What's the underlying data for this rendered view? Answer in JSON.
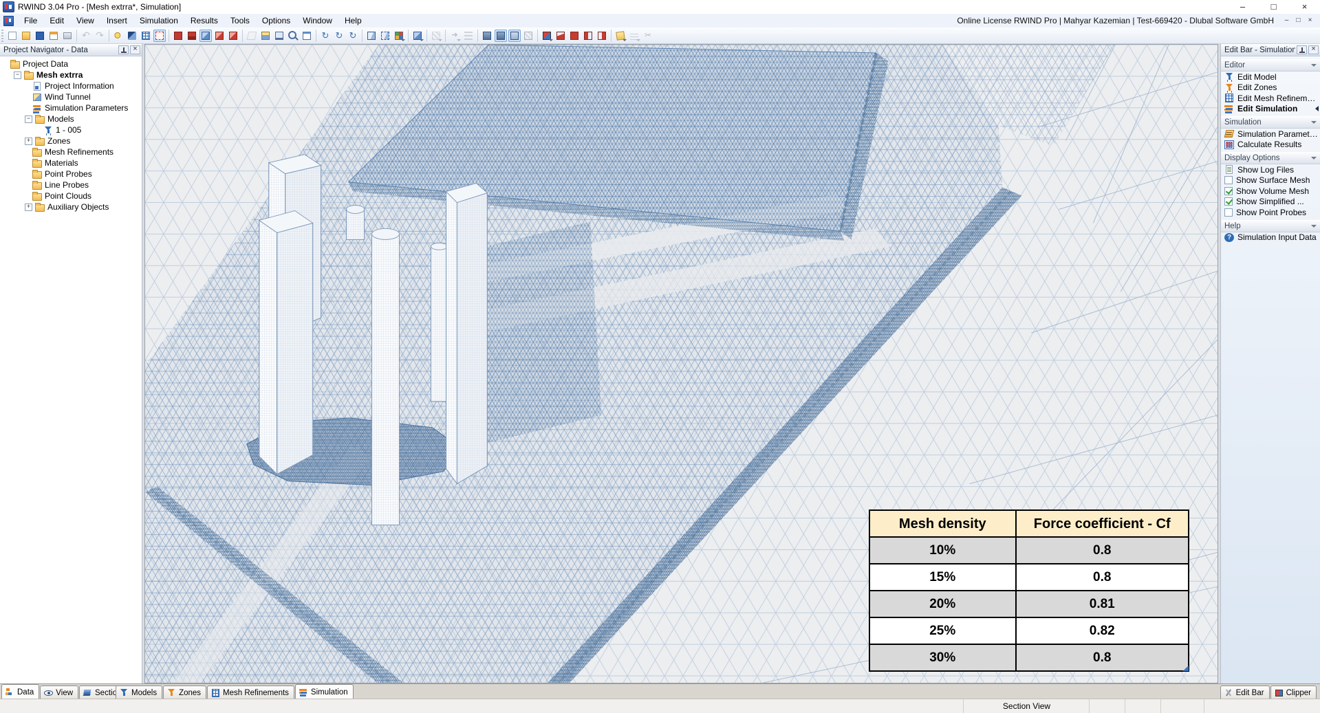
{
  "window": {
    "title": "RWIND 3.04 Pro - [Mesh extrra*, Simulation]"
  },
  "menu": {
    "items": [
      "File",
      "Edit",
      "View",
      "Insert",
      "Simulation",
      "Results",
      "Tools",
      "Options",
      "Window",
      "Help"
    ],
    "license": "Online License RWIND Pro | Mahyar Kazemian | Test-669420 - Dlubal Software GmbH"
  },
  "toolbar": {
    "icons": [
      {
        "name": "new-project",
        "kind": "sheet"
      },
      {
        "name": "open-project",
        "kind": "folder"
      },
      {
        "name": "save-project",
        "kind": "disk"
      },
      {
        "name": "project-navigator-toggle",
        "kind": "winpanel"
      },
      {
        "name": "print",
        "kind": "printer"
      },
      {
        "sep": true
      },
      {
        "name": "undo",
        "kind": "undo",
        "disabled": true
      },
      {
        "name": "redo",
        "kind": "redo",
        "disabled": true
      },
      {
        "sep": true
      },
      {
        "name": "generate-mesh",
        "kind": "spark"
      },
      {
        "name": "render-mode",
        "kind": "brush"
      },
      {
        "name": "finite-element-grid",
        "kind": "gridp"
      },
      {
        "name": "snap-grid",
        "kind": "snapred",
        "active": true
      },
      {
        "sep": true
      },
      {
        "name": "wind-tunnel-display",
        "kind": "redscreen"
      },
      {
        "name": "wind-tunnel-hide",
        "kind": "redscreen2"
      },
      {
        "name": "zone-box",
        "kind": "bluecube",
        "active": true
      },
      {
        "name": "zone-box-red",
        "kind": "redcube"
      },
      {
        "name": "zone-box-red-2",
        "kind": "redcube2"
      },
      {
        "sep": true
      },
      {
        "name": "screenshot",
        "kind": "grayiso",
        "disabled": true
      },
      {
        "name": "background-image",
        "kind": "imgfolder"
      },
      {
        "name": "display-window",
        "kind": "screen"
      },
      {
        "name": "zoom-window",
        "kind": "magnifier"
      },
      {
        "name": "message-log",
        "kind": "msgbox"
      },
      {
        "sep": true
      },
      {
        "name": "rotate-view",
        "kind": "rot"
      },
      {
        "name": "rotate-view-2",
        "kind": "rot"
      },
      {
        "name": "rotate-view-3",
        "kind": "rot"
      },
      {
        "sep": true
      },
      {
        "name": "isometric-view",
        "kind": "axcube"
      },
      {
        "name": "perspective-view",
        "kind": "axcube2"
      },
      {
        "name": "display-colors",
        "kind": "palette",
        "dd": true
      },
      {
        "sep": true
      },
      {
        "name": "solid-display",
        "kind": "bluecube",
        "dd": true
      },
      {
        "sep": true
      },
      {
        "name": "hatch-display",
        "kind": "hatch",
        "disabled": true,
        "dd": true
      },
      {
        "sep": true
      },
      {
        "name": "drag-mode",
        "kind": "movearrow",
        "disabled": true,
        "dd": true
      },
      {
        "name": "level-display",
        "kind": "levels",
        "disabled": true
      },
      {
        "sep": true
      },
      {
        "name": "surface-mesh-display",
        "kind": "face1"
      },
      {
        "name": "volume-mesh-display",
        "kind": "face2",
        "active": true
      },
      {
        "name": "simplified-mesh-display",
        "kind": "face3",
        "active": true
      },
      {
        "name": "probe-display",
        "kind": "face4",
        "disabled": true
      },
      {
        "sep": true
      },
      {
        "name": "clipping-box",
        "kind": "rbcube",
        "dd": true
      },
      {
        "name": "clip-front",
        "kind": "redwedge"
      },
      {
        "name": "clip-solid",
        "kind": "redbox"
      },
      {
        "name": "clip-left-half",
        "kind": "halfred"
      },
      {
        "name": "clip-right-half",
        "kind": "halfred2"
      },
      {
        "sep": true
      },
      {
        "name": "clipper-tool",
        "kind": "yclip",
        "dd": true
      },
      {
        "name": "streamlines",
        "kind": "windlines",
        "disabled": true,
        "dd": true
      },
      {
        "name": "cut-tool",
        "kind": "scissors",
        "disabled": true
      }
    ]
  },
  "navigator": {
    "title": "Project Navigator - Data",
    "tree": [
      {
        "label": "Project Data",
        "icon": "folder",
        "depth": 0
      },
      {
        "label": "Mesh extrra",
        "icon": "folder-open",
        "depth": 1,
        "bold": true,
        "expander": "minus"
      },
      {
        "label": "Project Information",
        "icon": "doc-info",
        "depth": 2
      },
      {
        "label": "Wind Tunnel",
        "icon": "tunnel",
        "depth": 2
      },
      {
        "label": "Simulation Parameters",
        "icon": "sim-params",
        "depth": 2
      },
      {
        "label": "Models",
        "icon": "folder",
        "depth": 2,
        "expander": "minus"
      },
      {
        "label": "1 - 005",
        "icon": "model",
        "depth": 3
      },
      {
        "label": "Zones",
        "icon": "folder",
        "depth": 2,
        "expander": "plus"
      },
      {
        "label": "Mesh Refinements",
        "icon": "folder",
        "depth": 2
      },
      {
        "label": "Materials",
        "icon": "folder",
        "depth": 2
      },
      {
        "label": "Point Probes",
        "icon": "folder",
        "depth": 2
      },
      {
        "label": "Line Probes",
        "icon": "folder",
        "depth": 2
      },
      {
        "label": "Point Clouds",
        "icon": "folder",
        "depth": 2
      },
      {
        "label": "Auxiliary Objects",
        "icon": "folder",
        "depth": 2,
        "expander": "plus"
      }
    ]
  },
  "editbar": {
    "title": "Edit Bar - Simulation",
    "groups": [
      {
        "label": "Editor",
        "items": [
          {
            "label": "Edit Model",
            "icon": "funnel-blue"
          },
          {
            "label": "Edit Zones",
            "icon": "funnel-orange"
          },
          {
            "label": "Edit Mesh Refinements",
            "icon": "grid-blue"
          },
          {
            "label": "Edit Simulation",
            "icon": "sim-orange",
            "bold": true,
            "arrow": true
          }
        ]
      },
      {
        "label": "Simulation",
        "items": [
          {
            "label": "Simulation Parameter...",
            "icon": "param"
          },
          {
            "label": "Calculate Results",
            "icon": "abacus"
          }
        ]
      },
      {
        "label": "Display Options",
        "items": [
          {
            "label": "Show Log Files",
            "icon": "doc"
          },
          {
            "label": "Show Surface Mesh",
            "checkbox": false
          },
          {
            "label": "Show Volume Mesh",
            "checkbox": true
          },
          {
            "label": "Show Simplified ...",
            "checkbox": true
          },
          {
            "label": "Show Point Probes",
            "checkbox": false
          }
        ]
      },
      {
        "label": "Help",
        "items": [
          {
            "label": "Simulation Input Data",
            "icon": "help"
          }
        ]
      }
    ]
  },
  "viewport": {
    "table": {
      "headers": [
        "Mesh density",
        "Force coefficient - Cf"
      ],
      "rows": [
        [
          "10%",
          "0.8"
        ],
        [
          "15%",
          "0.8"
        ],
        [
          "20%",
          "0.81"
        ],
        [
          "25%",
          "0.82"
        ],
        [
          "30%",
          "0.8"
        ]
      ],
      "header_bg": "#fdeec9",
      "row_alt_bg": "#d9d9d9"
    }
  },
  "tabs": {
    "left": [
      {
        "label": "Data",
        "icon": "data",
        "active": true
      },
      {
        "label": "View",
        "icon": "eye"
      },
      {
        "label": "Sections",
        "icon": "layers"
      }
    ],
    "center": [
      {
        "label": "Models",
        "icon": "funnel-blue"
      },
      {
        "label": "Zones",
        "icon": "funnel-orange"
      },
      {
        "label": "Mesh Refinements",
        "icon": "grid"
      },
      {
        "label": "Simulation",
        "icon": "sim",
        "active": true
      }
    ],
    "right": [
      {
        "label": "Edit Bar",
        "icon": "tools"
      },
      {
        "label": "Clipper",
        "icon": "clipcube"
      }
    ]
  },
  "statusbar": {
    "section_label": "Section View"
  },
  "colors": {
    "accent_blue": "#2e6db4",
    "mesh_blue": "#5d84af",
    "mesh_dark": "#49719c"
  }
}
